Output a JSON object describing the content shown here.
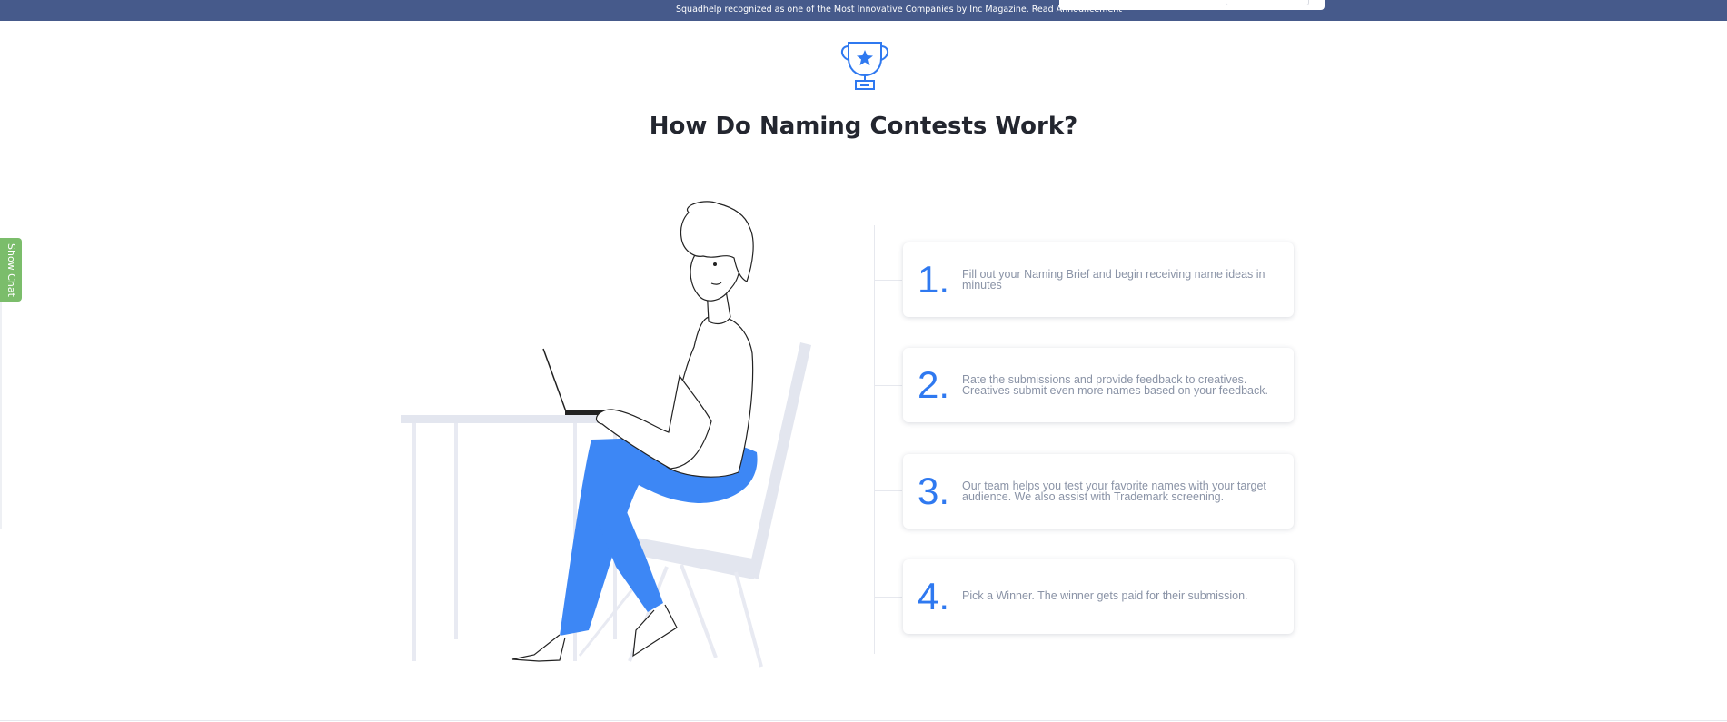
{
  "announcement": {
    "text": "Squadhelp recognized as one of the Most Innovative Companies by Inc Magazine.",
    "link": "Read Announcement"
  },
  "section": {
    "title": "How Do Naming Contests Work?"
  },
  "chat_tab": {
    "label": "Show Chat"
  },
  "steps": [
    {
      "number": "1.",
      "text": "Fill out your Naming Brief and begin receiving name ideas in minutes"
    },
    {
      "number": "2.",
      "text": "Rate the submissions and provide feedback to creatives. Creatives submit even more names based on your feedback."
    },
    {
      "number": "3.",
      "text": "Our team helps you test your favorite names with your target audience. We also assist with Trademark screening."
    },
    {
      "number": "4.",
      "text": "Pick a Winner. The winner gets paid for their submission."
    }
  ],
  "colors": {
    "banner": "#465a8b",
    "accent": "#2f79f0",
    "chat": "#7bbd6b",
    "illustration_blue": "#3d87f5"
  },
  "icons": {
    "trophy": "trophy-icon"
  }
}
